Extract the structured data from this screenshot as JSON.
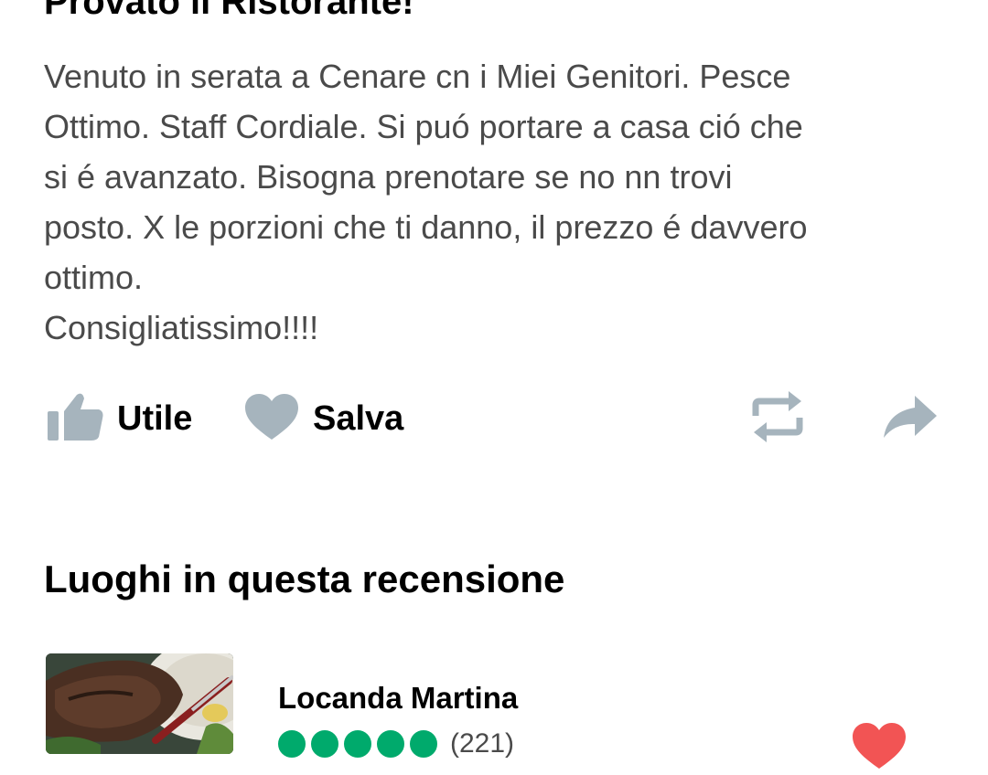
{
  "review": {
    "title": "Provato il Ristorante!",
    "body_lines": [
      "Venuto in serata a Cenare cn i Miei Genitori. Pesce",
      "Ottimo. Staff Cordiale. Si puó portare a casa ció che",
      "si é avanzato. Bisogna prenotare se no nn trovi",
      "posto. X le porzioni che ti danno, il prezzo é davvero",
      "ottimo.",
      "Consigliatissimo!!!!"
    ]
  },
  "actions": {
    "helpful_label": "Utile",
    "save_label": "Salva",
    "icons": {
      "helpful": "thumbs-up-icon",
      "save": "heart-icon",
      "repost": "repost-icon",
      "share": "share-arrow-icon"
    },
    "icon_color": "#a6b4bd"
  },
  "places_section": {
    "heading": "Luoghi in questa recensione",
    "places": [
      {
        "name": "Locanda Martina",
        "rating_count": "(221)",
        "rating_color": "#00aa6c",
        "favorite_icon": "heart-icon",
        "favorite_color": "#f25454"
      }
    ]
  }
}
